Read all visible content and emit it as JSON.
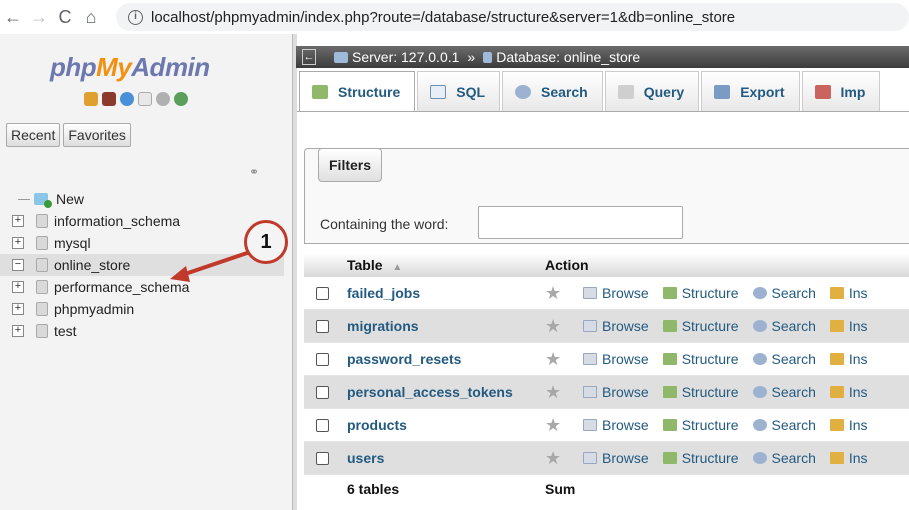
{
  "browser": {
    "url": "localhost/phpmyadmin/index.php?route=/database/structure&server=1&db=online_store",
    "back_icon": "arrow-left",
    "forward_icon": "arrow-right",
    "reload_icon": "reload",
    "home_icon": "home"
  },
  "nav": {
    "logo_part1": "php",
    "logo_part2": "My",
    "logo_part3": "Admin",
    "recent_label": "Recent",
    "favorites_label": "Favorites",
    "tree": [
      {
        "label": "New",
        "type": "new"
      },
      {
        "label": "information_schema",
        "type": "db"
      },
      {
        "label": "mysql",
        "type": "db"
      },
      {
        "label": "online_store",
        "type": "db",
        "selected": true
      },
      {
        "label": "performance_schema",
        "type": "db"
      },
      {
        "label": "phpmyadmin",
        "type": "db"
      },
      {
        "label": "test",
        "type": "db"
      }
    ]
  },
  "annotation": {
    "number": "1",
    "color": "#c0392b"
  },
  "breadcrumb": {
    "server": "Server: 127.0.0.1",
    "separator": "»",
    "database": "Database: online_store"
  },
  "tabs": [
    {
      "label": "Structure",
      "icon": "structure-icon",
      "active": true
    },
    {
      "label": "SQL",
      "icon": "sql-icon"
    },
    {
      "label": "Search",
      "icon": "search-icon"
    },
    {
      "label": "Query",
      "icon": "query-icon"
    },
    {
      "label": "Export",
      "icon": "export-icon"
    },
    {
      "label": "Imp",
      "icon": "import-icon"
    }
  ],
  "filters": {
    "legend": "Filters",
    "label": "Containing the word:",
    "value": ""
  },
  "table": {
    "headers": {
      "table": "Table",
      "sort_icon": "▲",
      "action": "Action"
    },
    "actions": [
      "Browse",
      "Structure",
      "Search",
      "Ins"
    ],
    "rows": [
      {
        "name": "failed_jobs"
      },
      {
        "name": "migrations"
      },
      {
        "name": "password_resets"
      },
      {
        "name": "personal_access_tokens"
      },
      {
        "name": "products"
      },
      {
        "name": "users"
      }
    ],
    "footer": {
      "count": "6 tables",
      "sum": "Sum"
    }
  },
  "colors": {
    "link": "#235a81",
    "logo_blue": "#6c78af",
    "logo_orange": "#f29111"
  }
}
